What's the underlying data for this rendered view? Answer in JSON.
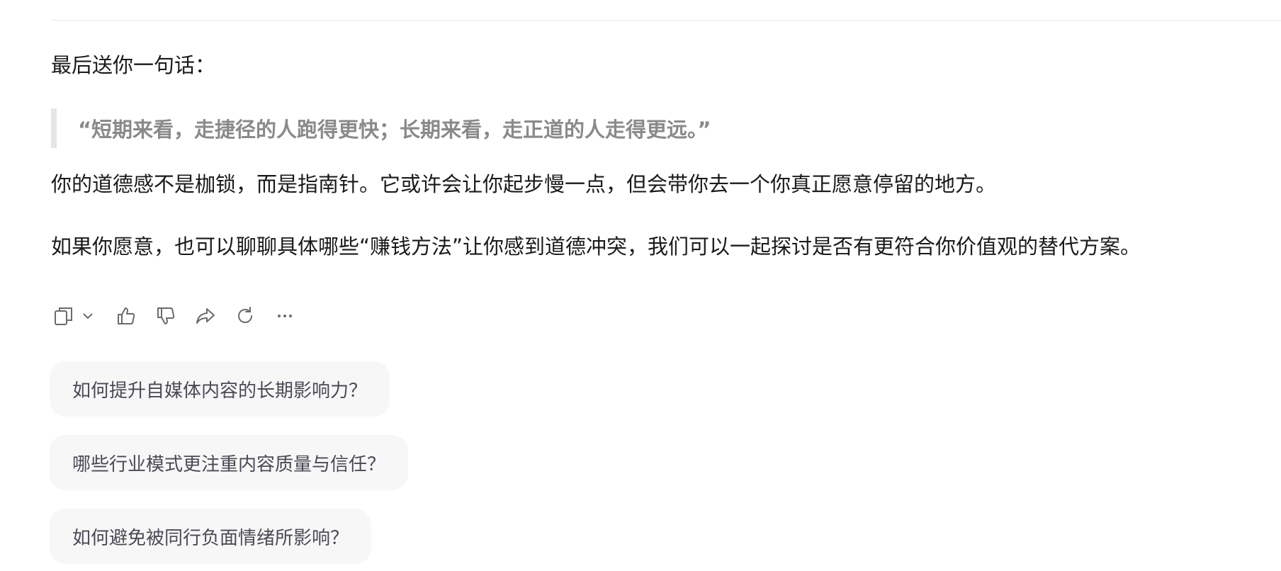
{
  "message": {
    "intro": "最后送你一句话：",
    "quote": "“短期来看，走捷径的人跑得更快；长期来看，走正道的人走得更远。”",
    "paragraph1": "你的道德感不是枷锁，而是指南针。它或许会让你起步慢一点，但会带你去一个你真正愿意停留的地方。",
    "paragraph2": "如果你愿意，也可以聊聊具体哪些“赚钱方法”让你感到道德冲突，我们可以一起探讨是否有更符合你价值观的替代方案。"
  },
  "actions": {
    "icons": [
      "copy-icon",
      "chevron-down-icon",
      "thumbs-up-icon",
      "thumbs-down-icon",
      "share-icon",
      "refresh-icon",
      "more-icon"
    ],
    "icon_color": "#6b6b6b"
  },
  "suggestions": [
    {
      "label": "如何提升自媒体内容的长期影响力？"
    },
    {
      "label": "哪些行业模式更注重内容质量与信任？"
    },
    {
      "label": "如何避免被同行负面情绪所影响？"
    }
  ],
  "colors": {
    "text": "#1a1a1a",
    "quote_text": "#8a8a8a",
    "quote_bar": "#e5e5e5",
    "suggestion_bg": "#f7f7f8",
    "suggestion_text": "#4a4a55"
  }
}
